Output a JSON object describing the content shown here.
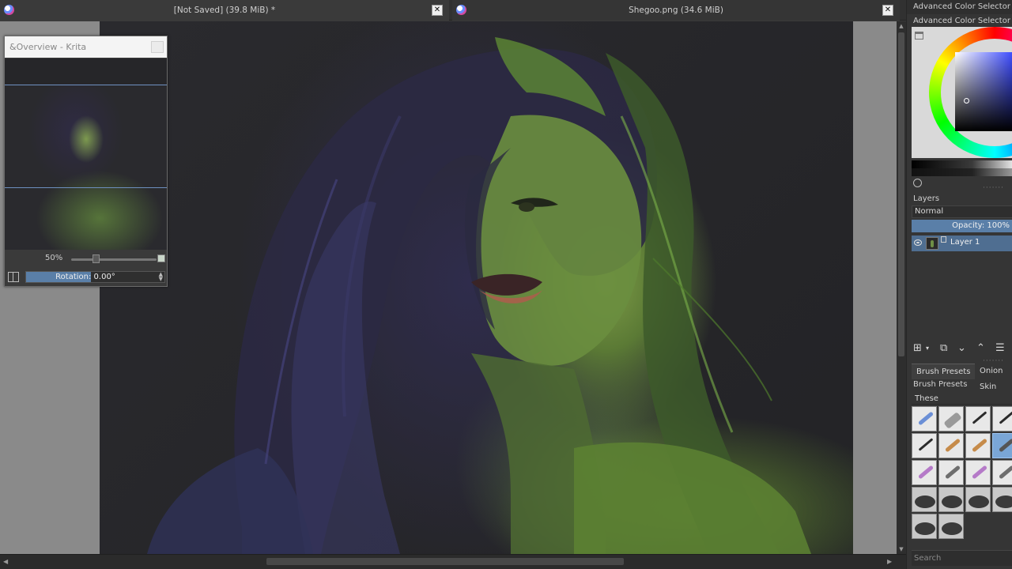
{
  "tabs": [
    {
      "title": "[Not Saved]  (39.8 MiB) *"
    },
    {
      "title": "Shegoo.png (34.6 MiB)"
    }
  ],
  "overview": {
    "window_title": "&Overview - Krita",
    "zoom_label": "50%",
    "rotation_label": "Rotation: 0.00°"
  },
  "dock": {
    "acs_header": "Advanced Color Selector",
    "acs_title": "Advanced Color Selector",
    "layers_title": "Layers",
    "blend_mode": "Normal",
    "opacity_label": "Opacity:  100%",
    "layer_name": "Layer 1",
    "brush_tab_active": "Brush Presets",
    "brush_tab_other": "Onion Skin",
    "brush_presets_title": "Brush Presets",
    "tag": "These",
    "search_placeholder": "Search"
  },
  "colors": {
    "accent_blue": "#5a7fa8",
    "selected_layer": "#4f6e91"
  }
}
